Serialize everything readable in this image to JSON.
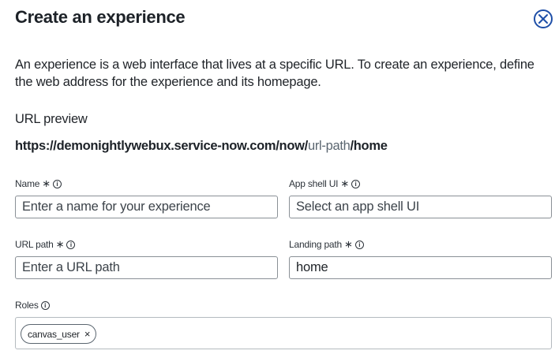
{
  "modal": {
    "title": "Create an experience",
    "description": "An experience is a web interface that lives at a specific URL. To create an experience, define the web address for the experience and its homepage."
  },
  "url_preview": {
    "label": "URL preview",
    "base": "https://demonightlywebux.service-now.com/now/",
    "path": "url-path",
    "suffix": "/home"
  },
  "fields": {
    "name": {
      "label": "Name",
      "required_mark": "∗",
      "value": "",
      "placeholder": "Enter a name for your experience"
    },
    "app_shell": {
      "label": "App shell UI",
      "required_mark": "∗",
      "value": "",
      "placeholder": "Select an app shell UI"
    },
    "url_path": {
      "label": "URL path",
      "required_mark": "∗",
      "value": "",
      "placeholder": "Enter a URL path"
    },
    "landing_path": {
      "label": "Landing path",
      "required_mark": "∗",
      "value": "home",
      "placeholder": ""
    },
    "roles": {
      "label": "Roles",
      "chips": [
        "canvas_user"
      ]
    }
  },
  "icons": {
    "close": "close-circle-icon",
    "info": "info-icon",
    "chip_remove": "×",
    "info_glyph": "i"
  },
  "colors": {
    "title": "#1d2228",
    "close_icon": "#1f4fa8",
    "border": "#8a9096",
    "path_text": "#5b6670"
  }
}
